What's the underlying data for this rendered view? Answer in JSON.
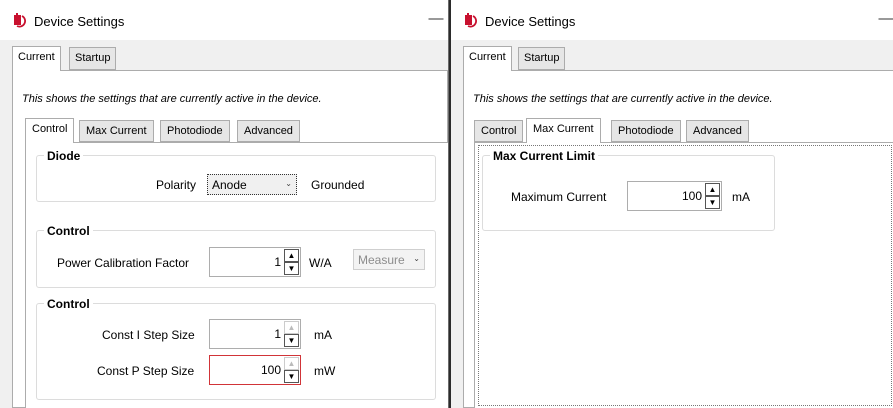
{
  "left": {
    "title": "Device Settings",
    "minimize": "—",
    "outer_tabs": [
      "Current",
      "Startup"
    ],
    "info": "This shows the settings that are currently active in the device.",
    "inner_tabs": [
      "Control",
      "Max Current",
      "Photodiode",
      "Advanced"
    ],
    "diode": {
      "title": "Diode",
      "polarity_label": "Polarity",
      "polarity_value": "Anode",
      "grounded": "Grounded"
    },
    "control1": {
      "title": "Control",
      "pcf_label": "Power Calibration Factor",
      "pcf_value": "1",
      "pcf_unit": "W/A",
      "measure": "Measure"
    },
    "control2": {
      "title": "Control",
      "consti_label": "Const I Step Size",
      "consti_value": "1",
      "consti_unit": "mA",
      "constp_label": "Const P Step Size",
      "constp_value": "100",
      "constp_unit": "mW"
    }
  },
  "right": {
    "title": "Device Settings",
    "minimize": "—",
    "outer_tabs": [
      "Current",
      "Startup"
    ],
    "info": "This shows the settings that are currently active in the device.",
    "inner_tabs": [
      "Control",
      "Max Current",
      "Photodiode",
      "Advanced"
    ],
    "maxcurrent": {
      "title": "Max Current Limit",
      "label": "Maximum Current",
      "value": "100",
      "unit": "mA"
    }
  },
  "icons": {
    "spin_up": "▲",
    "spin_down": "▼",
    "dropdown": "⌄"
  },
  "colors": {
    "error_border": "#d13438",
    "icon_red": "#c8102e"
  }
}
